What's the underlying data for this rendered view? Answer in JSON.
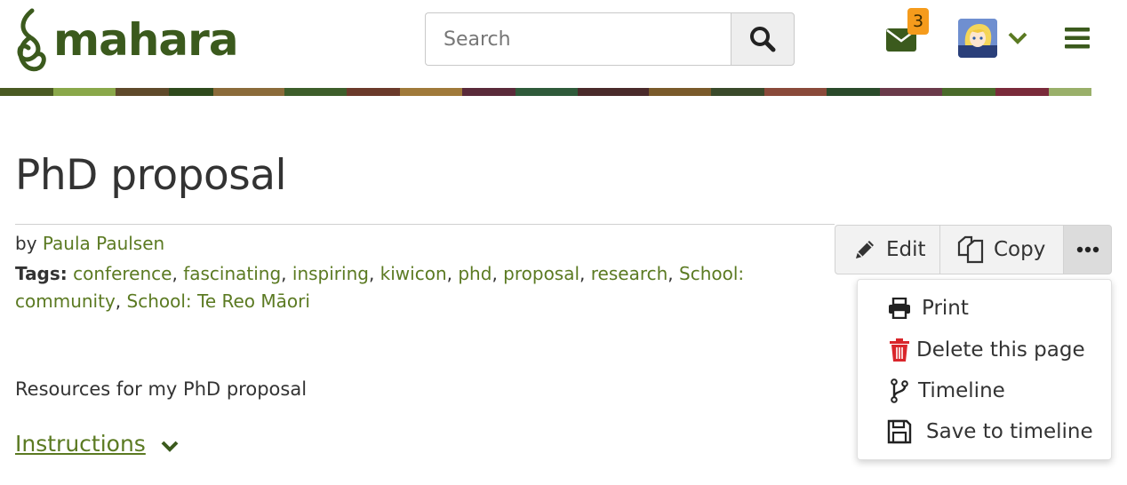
{
  "header": {
    "logo_text": "mahara",
    "search": {
      "placeholder": "Search",
      "button_icon": "search-icon"
    },
    "notifications": {
      "icon": "envelope-icon",
      "count": "3"
    },
    "user_menu": {
      "avatar": "avatar",
      "icon": "chevron-down-icon"
    },
    "main_menu": {
      "icon": "hamburger-icon"
    }
  },
  "page": {
    "title": "PhD proposal",
    "by_label": "by",
    "author": "Paula Paulsen",
    "tags_label": "Tags:",
    "tags": [
      "conference",
      "fascinating",
      "inspiring",
      "kiwicon",
      "phd",
      "proposal",
      "research",
      "School: community",
      "School: Te Reo Māori"
    ],
    "description": "Resources for my PhD proposal",
    "instructions_label": "Instructions"
  },
  "actions": {
    "edit_label": "Edit",
    "copy_label": "Copy",
    "more_icon": "ellipsis-icon"
  },
  "more_menu": {
    "items": [
      {
        "label": "Print",
        "icon": "print-icon"
      },
      {
        "label": "Delete this page",
        "icon": "trash-icon"
      },
      {
        "label": "Timeline",
        "icon": "branch-icon"
      },
      {
        "label": "Save to timeline",
        "icon": "save-icon"
      }
    ]
  },
  "colors": {
    "brand_green": "#3b5a1d",
    "link_green": "#5b7a22",
    "badge_orange": "#f59b1c",
    "delete_red": "#d9262b"
  }
}
